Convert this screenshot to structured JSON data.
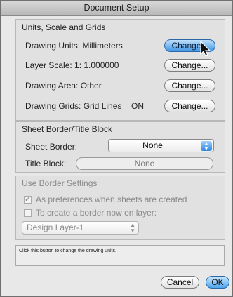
{
  "window": {
    "title": "Document Setup"
  },
  "units_group": {
    "title": "Units, Scale and Grids",
    "rows": [
      {
        "label": "Drawing Units:  Millimeters",
        "button": "Change..."
      },
      {
        "label": "Layer Scale:  1:  1.000000",
        "button": "Change..."
      },
      {
        "label": "Drawing Area:  Other",
        "button": "Change..."
      },
      {
        "label": "Drawing Grids:  Grid Lines = ON",
        "button": "Change..."
      }
    ]
  },
  "border_group": {
    "title": "Sheet Border/Title Block",
    "sheet_border_label": "Sheet Border:",
    "sheet_border_value": "None",
    "title_block_label": "Title Block:",
    "title_block_value": "None"
  },
  "use_border": {
    "title": "Use Border Settings",
    "option1": "As preferences when sheets are created",
    "option1_checked": true,
    "option2": "To create a border now on layer:",
    "option2_checked": false,
    "layer_value": "Design Layer-1"
  },
  "status_text": "Click this button to change the drawing units.",
  "buttons": {
    "cancel": "Cancel",
    "ok": "OK"
  },
  "colors": {
    "accent": "#3f97e6",
    "background": "#e8e8e8"
  }
}
